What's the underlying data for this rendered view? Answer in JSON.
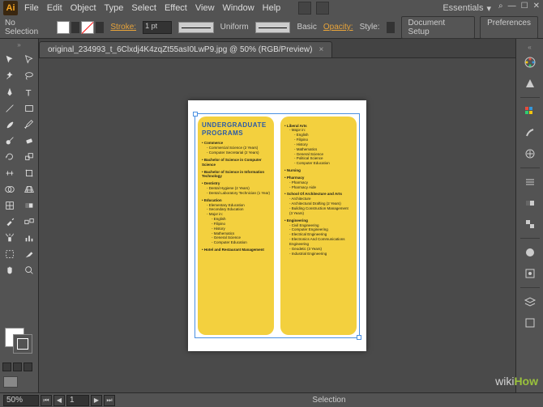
{
  "menu": [
    "File",
    "Edit",
    "Object",
    "Type",
    "Select",
    "Effect",
    "View",
    "Window",
    "Help"
  ],
  "workspace": "Essentials",
  "control": {
    "noSelection": "No Selection",
    "strokeLabel": "Stroke:",
    "strokeVal": "1 pt",
    "uniform": "Uniform",
    "basic": "Basic",
    "opacity": "Opacity:",
    "styleLabel": "Style:",
    "docSetup": "Document Setup",
    "prefs": "Preferences"
  },
  "tab": {
    "name": "original_234993_t_6Clxdj4K4zqZt55asI0LwP9.jpg @ 50% (RGB/Preview)"
  },
  "status": {
    "zoom": "50%",
    "page": "1",
    "tool": "Selection"
  },
  "doc": {
    "title": "UNDERGRADUATE PROGRAMS",
    "left": [
      {
        "h": "Commerce",
        "items": [
          "Commercial Science (2 Years)",
          "Computer Secretarial (2 Years)"
        ]
      },
      {
        "h": "Bachelor of Science in Computer Science"
      },
      {
        "h": "Bachelor of Science in Information Technology"
      },
      {
        "h": "Dentistry",
        "items": [
          "Dental Hygiene (2 Years)",
          "Dental Laboratory Technician (1 Year)"
        ]
      },
      {
        "h": "Education",
        "items": [
          "Elementary Education",
          "Secondary Education",
          "Major in:"
        ],
        "subs": [
          "English",
          "Filipino",
          "History",
          "Mathematics",
          "General Science",
          "Computer Education"
        ]
      },
      {
        "h": "Hotel and Restaurant Management"
      }
    ],
    "right": [
      {
        "h": "Liberal Arts",
        "items": [
          "Major in:"
        ],
        "subs": [
          "English",
          "Filipino",
          "History",
          "Mathematics",
          "General Science",
          "Political Science",
          "Computer Education"
        ]
      },
      {
        "h": "Nursing"
      },
      {
        "h": "Pharmacy",
        "items": [
          "Pharmacy",
          "Pharmacy Aide"
        ]
      },
      {
        "h": "School Of Architecture and Arts",
        "items": [
          "Architecture",
          "Architectural Drafting (2 Years)",
          "Building Construction Management (3 Years)"
        ]
      },
      {
        "h": "Engineering",
        "items": [
          "Civil Engineering",
          "Computer Engineering",
          "Electrical Engineering",
          "Electronics And Communications Engineering",
          "Geodetic (3 Years)",
          "Industrial Engineering"
        ]
      }
    ]
  },
  "watermark": {
    "a": "wiki",
    "b": "How"
  }
}
